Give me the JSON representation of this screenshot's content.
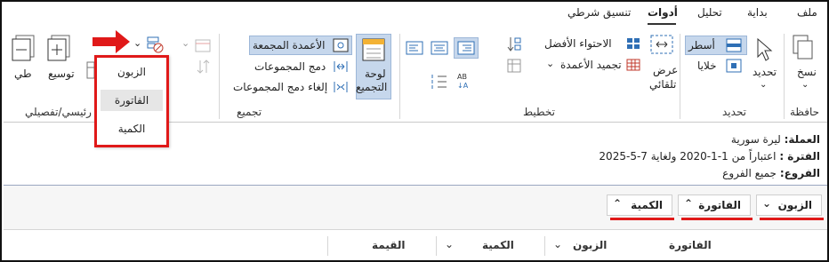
{
  "menu": {
    "items": [
      "ملف",
      "بداية",
      "تحليل",
      "أدوات",
      "تنسيق شرطي"
    ],
    "active": "أدوات"
  },
  "clipboard": {
    "copy": "نسخ",
    "group": "حافظة"
  },
  "select": {
    "select_label": "تحديد",
    "rows": "أسطر",
    "cells": "خلايا",
    "group": "تحديد"
  },
  "layout": {
    "autofit_line1": "عرض",
    "autofit_line2": "تلقائي",
    "best_fit": "الاحتواء الأفضل",
    "freeze": "تجميد الأعمدة",
    "group": "تخطيط"
  },
  "grouping": {
    "panel_line1": "لوحة",
    "panel_line2": "التجميع",
    "grouped_cols": "الأعمدة المجمعة",
    "merge": "دمج المجموعات",
    "unmerge": "إلغاء دمج المجموعات",
    "group": "تجميع"
  },
  "outline": {
    "expand": "توسيع",
    "collapse": "طي",
    "group": "رئيسي/تفصيلي"
  },
  "dropdown": {
    "items": [
      "الزبون",
      "الفاتورة",
      "الكمية"
    ],
    "hovered": "الفاتورة"
  },
  "info": {
    "currency_label": "العملة:",
    "currency_value": "ليرة سورية",
    "period_label": "الفترة :",
    "period_value": "اعتباراً من 1-1-2020 ولغاية 7-5-2025",
    "branch_label": "الفروع:",
    "branch_value": "جميع الفروع"
  },
  "group_chips": [
    "الزبون",
    "الفاتورة",
    "الكمية"
  ],
  "columns": [
    "الفاتورة",
    "الزبون",
    "الكمية",
    "القيمة"
  ],
  "colors": {
    "accent": "#2f6fb5",
    "highlight": "#e01919",
    "selected": "#c6d7ec"
  }
}
